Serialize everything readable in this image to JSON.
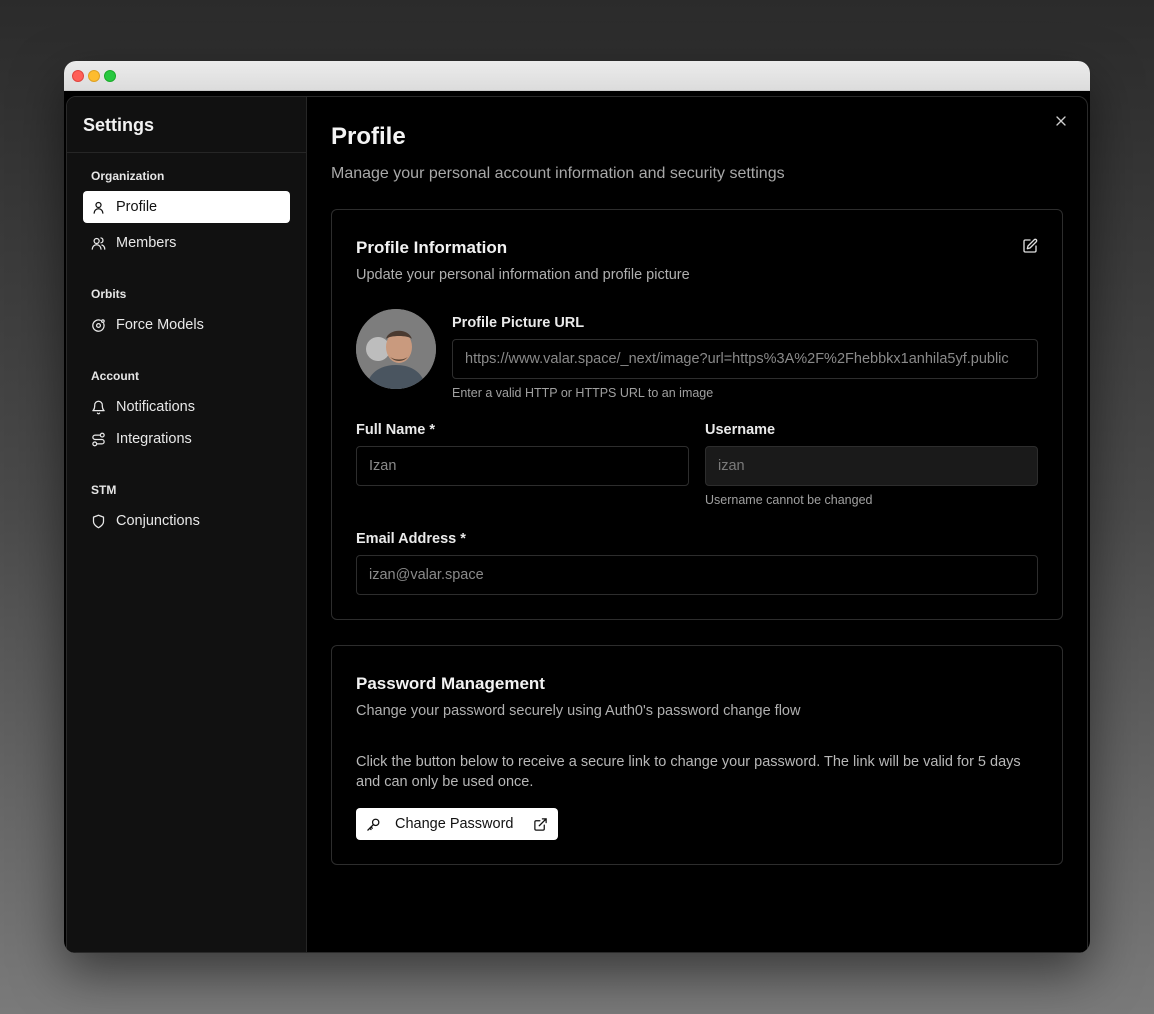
{
  "sidebar": {
    "title": "Settings",
    "groups": [
      {
        "label": "Organization",
        "items": [
          {
            "label": "Profile",
            "icon": "user-icon",
            "active": true
          },
          {
            "label": "Members",
            "icon": "users-icon"
          }
        ]
      },
      {
        "label": "Orbits",
        "items": [
          {
            "label": "Force Models",
            "icon": "orbit-icon"
          }
        ]
      },
      {
        "label": "Account",
        "items": [
          {
            "label": "Notifications",
            "icon": "bell-icon"
          },
          {
            "label": "Integrations",
            "icon": "route-icon"
          }
        ]
      },
      {
        "label": "STM",
        "items": [
          {
            "label": "Conjunctions",
            "icon": "shield-icon"
          }
        ]
      }
    ]
  },
  "main": {
    "title": "Profile",
    "subtitle": "Manage your personal account information and security settings"
  },
  "profile_card": {
    "title": "Profile Information",
    "subtitle": "Update your personal information and profile picture",
    "picture_url_label": "Profile Picture URL",
    "picture_url_value": "https://www.valar.space/_next/image?url=https%3A%2F%2Fhebbkx1anhila5yf.public",
    "picture_url_hint": "Enter a valid HTTP or HTTPS URL to an image",
    "full_name_label": "Full Name *",
    "full_name_value": "Izan",
    "username_label": "Username",
    "username_value": "izan",
    "username_hint": "Username cannot be changed",
    "email_label": "Email Address *",
    "email_value": "izan@valar.space"
  },
  "password_card": {
    "title": "Password Management",
    "subtitle": "Change your password securely using Auth0's password change flow",
    "body": "Click the button below to receive a secure link to change your password. The link will be valid for 5 days and can only be used once.",
    "button_label": "Change Password"
  },
  "colors": {
    "background": "#000000",
    "sidebar": "#111111",
    "border": "#2d2d2d",
    "active_item": "#ffffff"
  }
}
